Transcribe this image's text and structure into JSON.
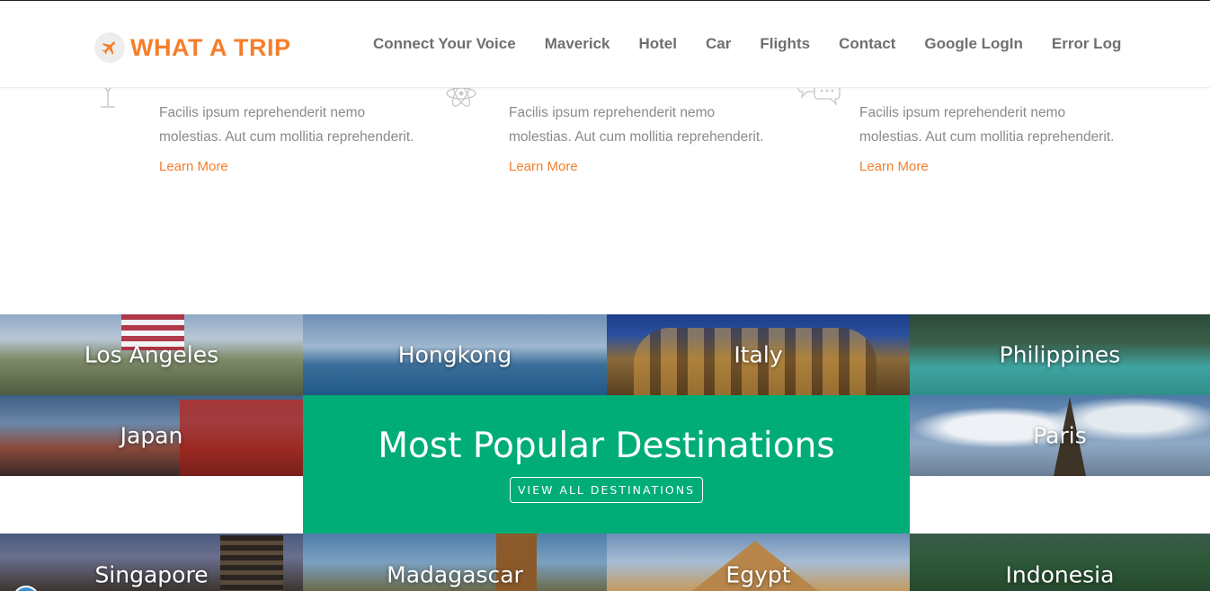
{
  "brand": {
    "name": "WHAT A TRIP",
    "color": "#f47e2b",
    "icon": "airplane-icon"
  },
  "nav": {
    "items": [
      {
        "label": "Connect Your Voice"
      },
      {
        "label": "Maverick"
      },
      {
        "label": "Hotel"
      },
      {
        "label": "Car"
      },
      {
        "label": "Flights"
      },
      {
        "label": "Contact"
      },
      {
        "label": "Google LogIn"
      },
      {
        "label": "Error Log"
      }
    ]
  },
  "features": [
    {
      "icon": "drink-glass-icon",
      "text": "Facilis ipsum reprehenderit nemo molestias. Aut cum mollitia reprehenderit.",
      "link": "Learn More"
    },
    {
      "icon": "atom-icon",
      "text": "Facilis ipsum reprehenderit nemo molestias. Aut cum mollitia reprehenderit.",
      "link": "Learn More"
    },
    {
      "icon": "chat-bubbles-icon",
      "text": "Facilis ipsum reprehenderit nemo molestias. Aut cum mollitia reprehenderit.",
      "link": "Learn More"
    }
  ],
  "destinations": [
    {
      "name": "Los Angeles"
    },
    {
      "name": "Hongkong"
    },
    {
      "name": "Italy"
    },
    {
      "name": "Philippines"
    },
    {
      "name": "Japan"
    },
    {
      "name": "Paris"
    },
    {
      "name": "Singapore"
    },
    {
      "name": "Madagascar"
    },
    {
      "name": "Egypt"
    },
    {
      "name": "Indonesia"
    }
  ],
  "popular": {
    "title": "Most Popular Destinations",
    "button": "VIEW ALL DESTINATIONS",
    "color": "#00ad76"
  }
}
